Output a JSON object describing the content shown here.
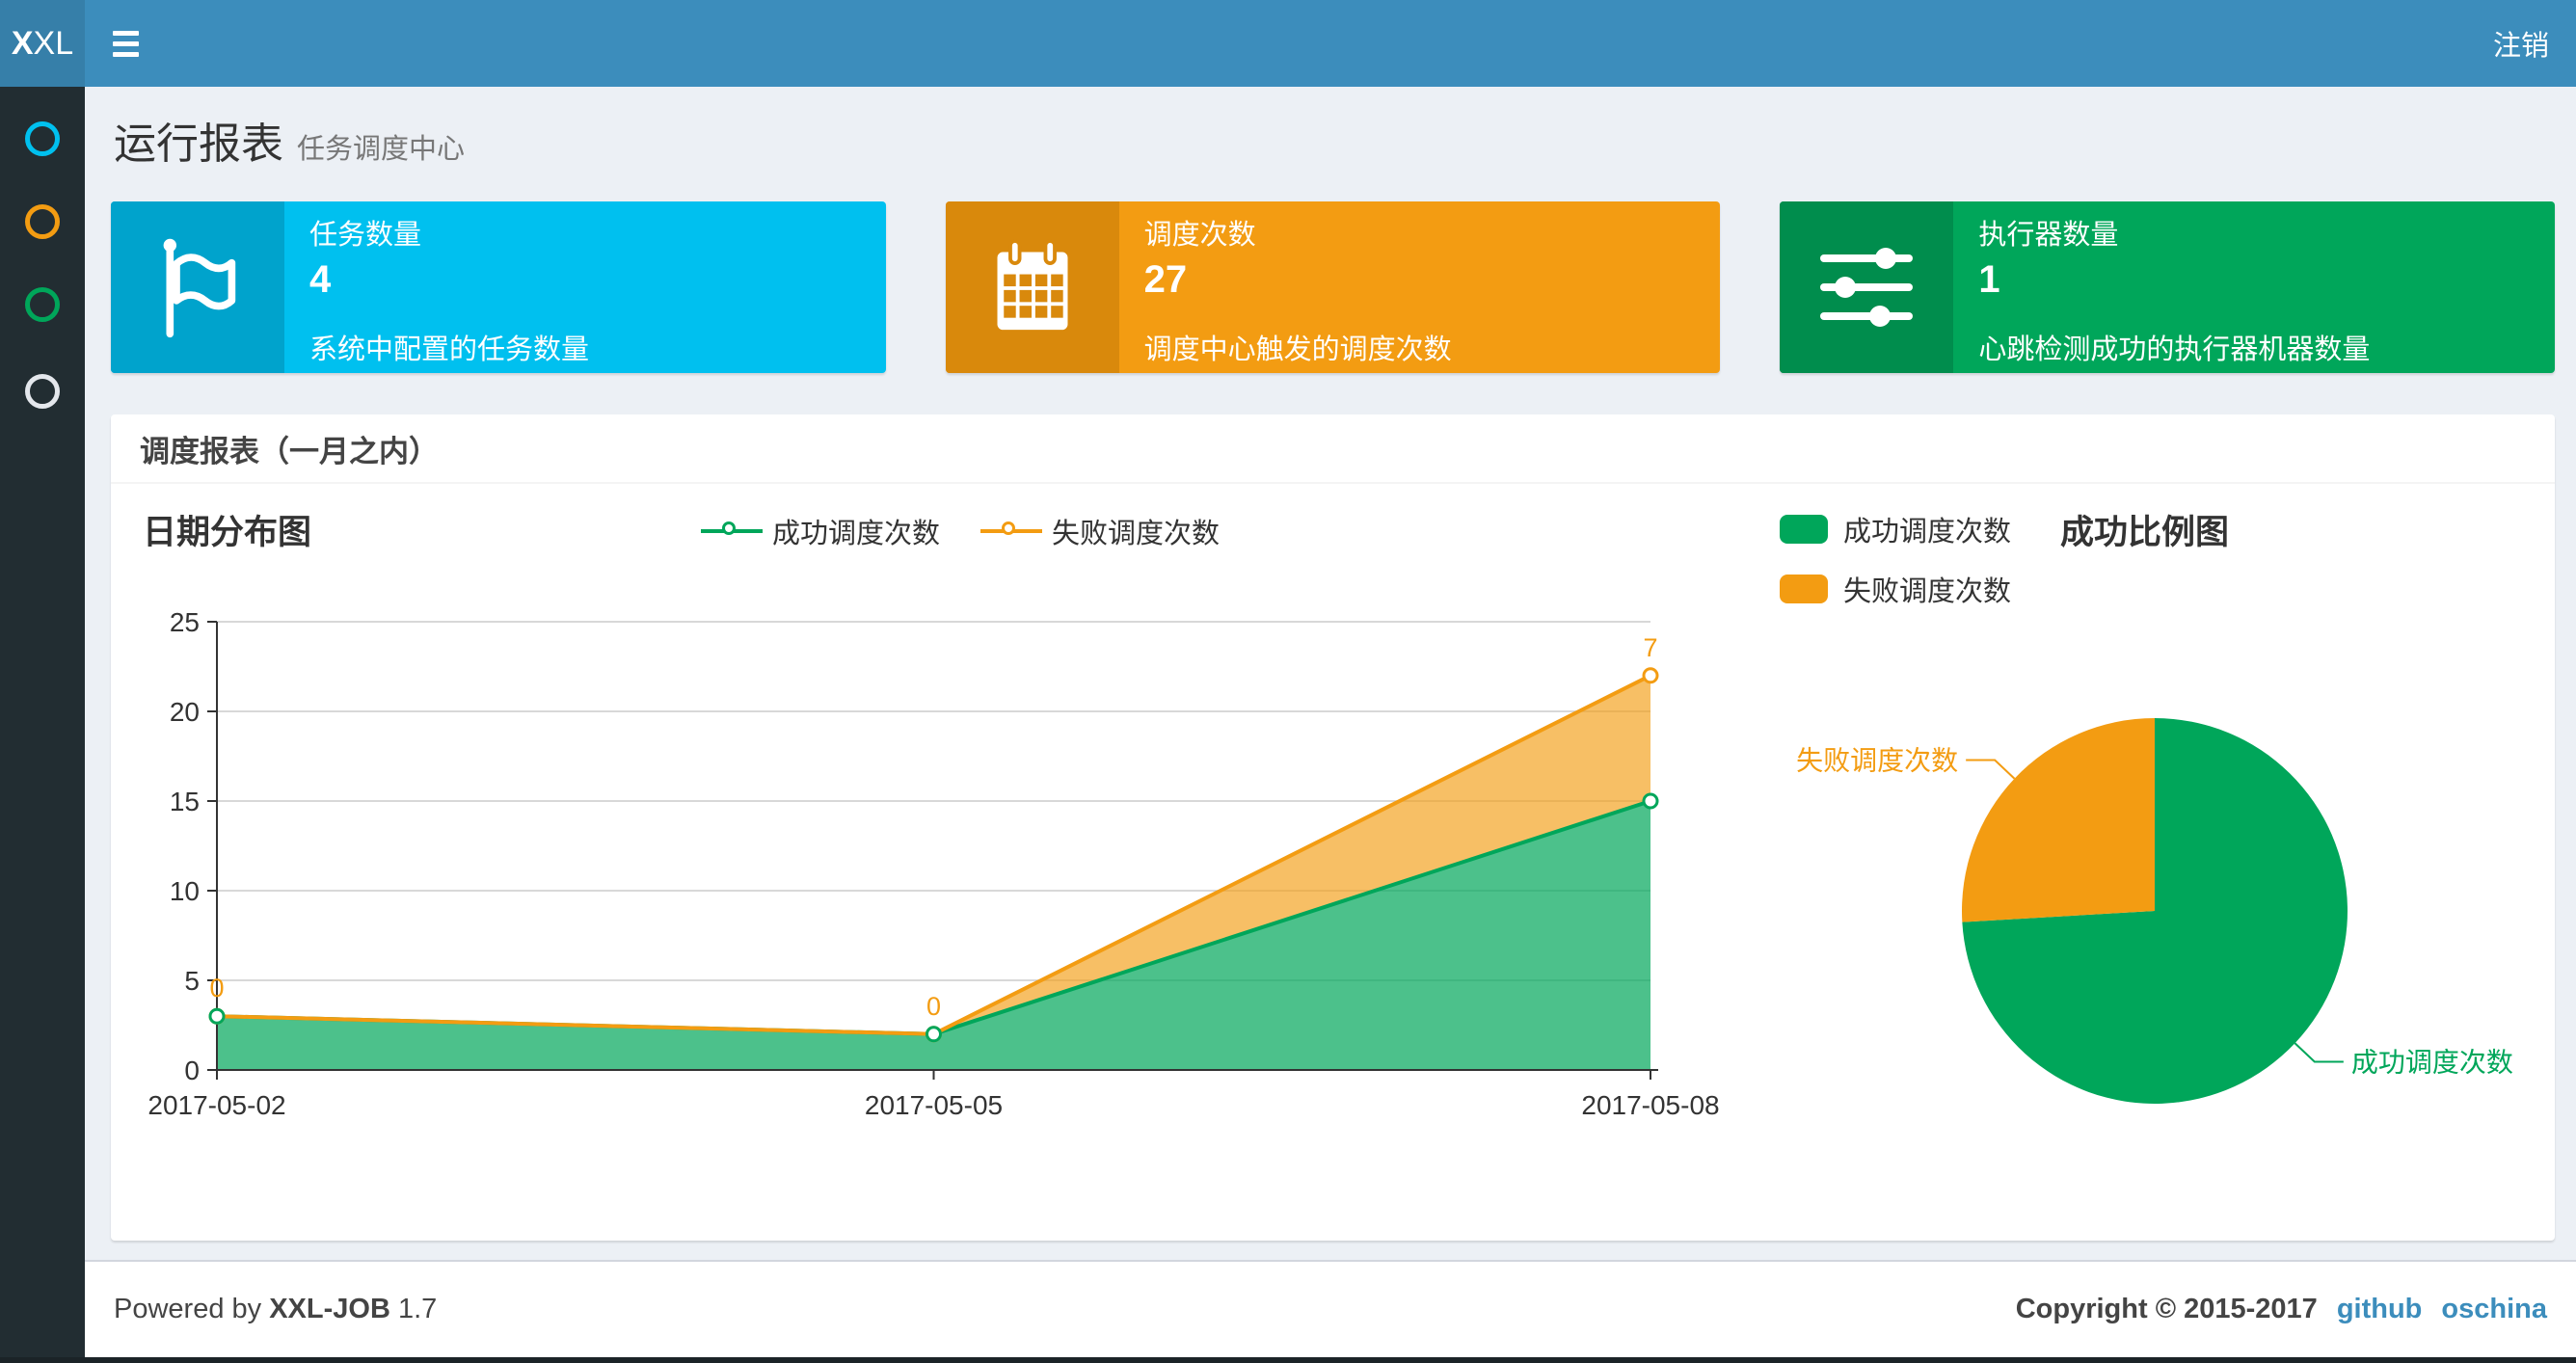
{
  "navbar": {
    "logo_bold": "X",
    "logo_light": "XL",
    "logout_label": "注销"
  },
  "sidebar": {
    "items": [
      {
        "icon": "circle-icon-aqua",
        "color": "#00c0ef"
      },
      {
        "icon": "circle-icon-orange",
        "color": "#f39c12"
      },
      {
        "icon": "circle-icon-green",
        "color": "#00a65a"
      },
      {
        "icon": "circle-icon-white",
        "color": "#e4e7ec"
      }
    ]
  },
  "page_header": {
    "title": "运行报表",
    "subtitle": "任务调度中心"
  },
  "info_boxes": [
    {
      "label": "任务数量",
      "value": "4",
      "description": "系统中配置的任务数量",
      "color": "#00c0ef",
      "icon": "flag-icon"
    },
    {
      "label": "调度次数",
      "value": "27",
      "description": "调度中心触发的调度次数",
      "color": "#f39c12",
      "icon": "calendar-icon"
    },
    {
      "label": "执行器数量",
      "value": "1",
      "description": "心跳检测成功的执行器机器数量",
      "color": "#00a65a",
      "icon": "sliders-icon"
    }
  ],
  "panel": {
    "title": "调度报表（一月之内）"
  },
  "chart_data": [
    {
      "type": "area",
      "title": "日期分布图",
      "x": [
        "2017-05-02",
        "2017-05-05",
        "2017-05-08"
      ],
      "series": [
        {
          "name": "成功调度次数",
          "values": [
            3,
            2,
            15
          ],
          "color": "#00A65A",
          "show_labels": false
        },
        {
          "name": "失败调度次数",
          "values": [
            0,
            0,
            7
          ],
          "color": "#F39C12",
          "show_labels": true
        }
      ],
      "stacked": true,
      "ylim": [
        0,
        25
      ],
      "ytick_interval": 5,
      "grid": true,
      "legend_position": "top"
    },
    {
      "type": "pie",
      "title": "成功比例图",
      "slices": [
        {
          "name": "成功调度次数",
          "value": 20,
          "color": "#00A65A"
        },
        {
          "name": "失败调度次数",
          "value": 7,
          "color": "#F39C12"
        }
      ],
      "legend_position": "top-left"
    }
  ],
  "footer": {
    "powered_prefix": "Powered by",
    "product": "XXL-JOB",
    "version": "1.7",
    "copyright": "Copyright © 2015-2017",
    "links": [
      "github",
      "oschina"
    ]
  }
}
